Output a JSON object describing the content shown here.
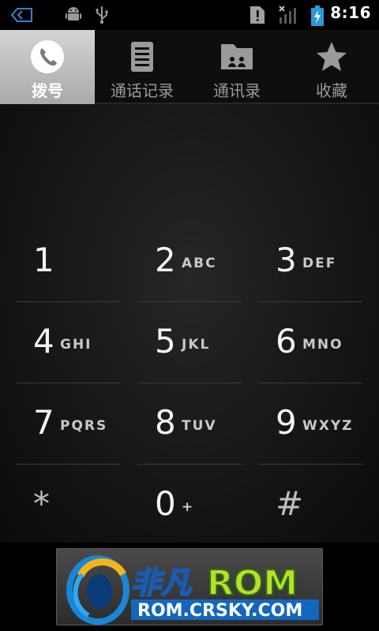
{
  "status_bar": {
    "time": "8:16",
    "icons": [
      "back-arrow-icon",
      "android-debug-icon",
      "usb-icon",
      "alert-icon",
      "signal-icon",
      "battery-charging-icon"
    ]
  },
  "tabs": [
    {
      "label": "拨号",
      "icon": "phone-handset-icon",
      "active": true
    },
    {
      "label": "通话记录",
      "icon": "call-log-icon",
      "active": false
    },
    {
      "label": "通讯录",
      "icon": "contacts-icon",
      "active": false
    },
    {
      "label": "收藏",
      "icon": "star-icon",
      "active": false
    }
  ],
  "keypad": [
    {
      "digit": "1",
      "letters": ""
    },
    {
      "digit": "2",
      "letters": "ABC"
    },
    {
      "digit": "3",
      "letters": "DEF"
    },
    {
      "digit": "4",
      "letters": "GHI"
    },
    {
      "digit": "5",
      "letters": "JKL"
    },
    {
      "digit": "6",
      "letters": "MNO"
    },
    {
      "digit": "7",
      "letters": "PQRS"
    },
    {
      "digit": "8",
      "letters": "TUV"
    },
    {
      "digit": "9",
      "letters": "WXYZ"
    },
    {
      "digit": "*",
      "letters": ""
    },
    {
      "digit": "0",
      "letters": "+"
    },
    {
      "digit": "#",
      "letters": ""
    }
  ],
  "watermark": {
    "brand_cn": "非凡",
    "brand_rom": "ROM",
    "url": "ROM.CRSKY.COM"
  },
  "colors": {
    "active_tab_bg": "#c0c0c0",
    "rom_green": "#b8e02a",
    "brand_blue": "#1a86d8",
    "battery_blue": "#2a9ad8"
  }
}
